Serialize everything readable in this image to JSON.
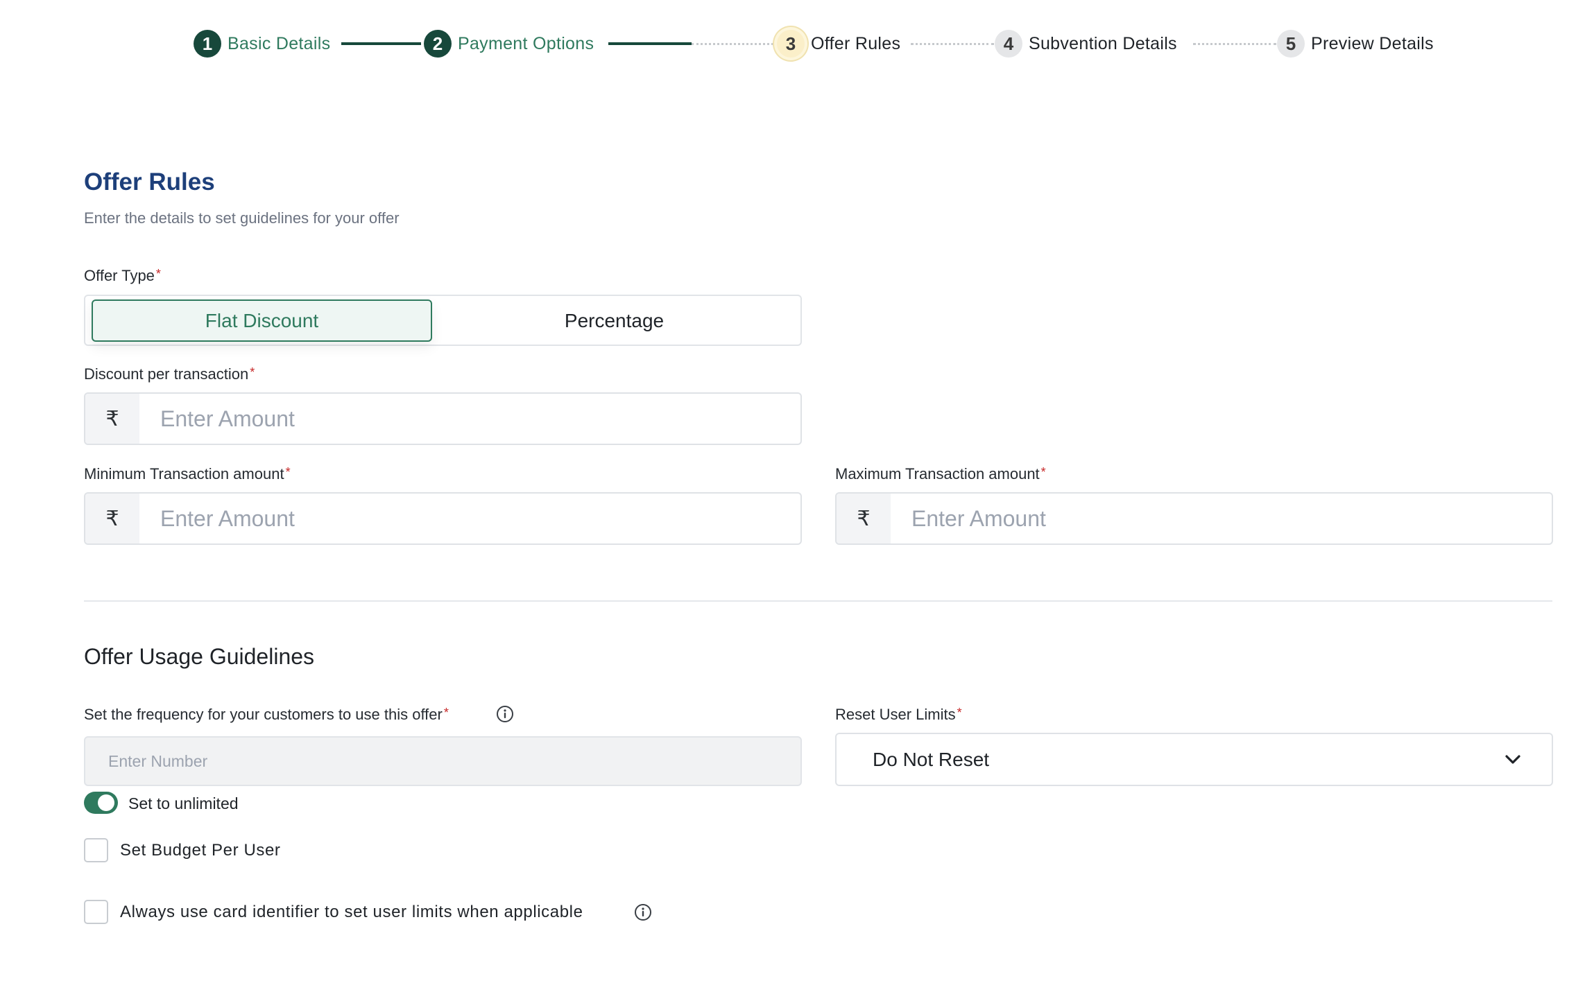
{
  "stepper": {
    "steps": [
      {
        "number": "1",
        "label": "Basic Details",
        "state": "done"
      },
      {
        "number": "2",
        "label": "Payment Options",
        "state": "done"
      },
      {
        "number": "3",
        "label": "Offer Rules",
        "state": "current"
      },
      {
        "number": "4",
        "label": "Subvention Details",
        "state": "todo"
      },
      {
        "number": "5",
        "label": "Preview Details",
        "state": "todo"
      }
    ]
  },
  "header": {
    "title": "Offer Rules",
    "subtitle": "Enter the details to set guidelines for your offer"
  },
  "offer_type": {
    "label": "Offer Type",
    "required_mark": "*",
    "options": [
      "Flat Discount",
      "Percentage"
    ],
    "selected": "Flat Discount"
  },
  "discount": {
    "label": "Discount per transaction",
    "required_mark": "*",
    "currency": "₹",
    "placeholder": "Enter Amount"
  },
  "min_txn": {
    "label": "Minimum Transaction amount",
    "required_mark": "*",
    "currency": "₹",
    "placeholder": "Enter Amount"
  },
  "max_txn": {
    "label": "Maximum Transaction amount",
    "required_mark": "*",
    "currency": "₹",
    "placeholder": "Enter Amount"
  },
  "usage": {
    "heading": "Offer Usage Guidelines",
    "frequency_label": "Set the frequency for your customers to use this offer",
    "frequency_required": "*",
    "frequency_placeholder": "Enter Number",
    "unlimited_label": "Set to unlimited",
    "unlimited_on": true,
    "reset_label": "Reset User Limits",
    "reset_required": "*",
    "reset_value": "Do Not Reset",
    "budget_label": "Set Budget Per User",
    "card_identifier_label": "Always use card identifier to set user limits when applicable"
  },
  "colors": {
    "primary": "#17483b",
    "accent_green": "#2f7a5e",
    "title_blue": "#1d3f7a",
    "required_red": "#c62828"
  }
}
